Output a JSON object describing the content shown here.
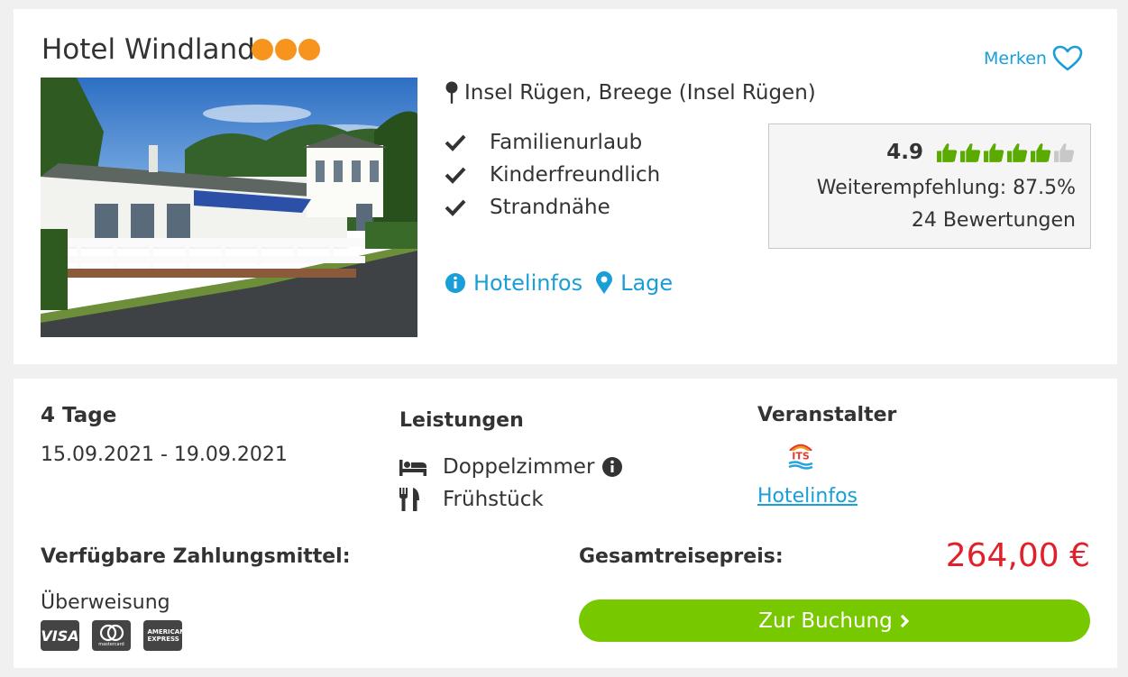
{
  "hotel": {
    "name": "Hotel Windland",
    "stars": 3,
    "save_label": "Merken",
    "location": "Insel Rügen, Breege (Insel Rügen)",
    "features": [
      "Familienurlaub",
      "Kinderfreundlich",
      "Strandnähe"
    ],
    "rating": {
      "score": "4.9",
      "thumbs_filled": 5,
      "thumbs_total": 6,
      "recommendation": "Weiterempfehlung: 87.5%",
      "reviews": "24 Bewertungen"
    },
    "links": {
      "info": "Hotelinfos",
      "location": "Lage"
    }
  },
  "offer": {
    "duration": "4 Tage",
    "dates": "15.09.2021 - 19.09.2021",
    "services_heading": "Leistungen",
    "room": "Doppelzimmer",
    "board": "Frühstück",
    "operator_heading": "Veranstalter",
    "operator_logo": "ITS",
    "operator_link": "Hotelinfos",
    "payment_heading": "Verfügbare Zahlungsmittel:",
    "payment_method": "Überweisung",
    "payment_cards": [
      "VISA",
      "mastercard",
      "AMERICAN EXPRESS"
    ],
    "total_heading": "Gesamtreisepreis:",
    "price": "264,00 €",
    "book_label": "Zur Buchung"
  },
  "colors": {
    "accent": "#199ed8",
    "star": "#f7941d",
    "price": "#e0202a",
    "button": "#78c800",
    "thumb_on": "#5aaa00",
    "thumb_off": "#c8c8c8"
  }
}
